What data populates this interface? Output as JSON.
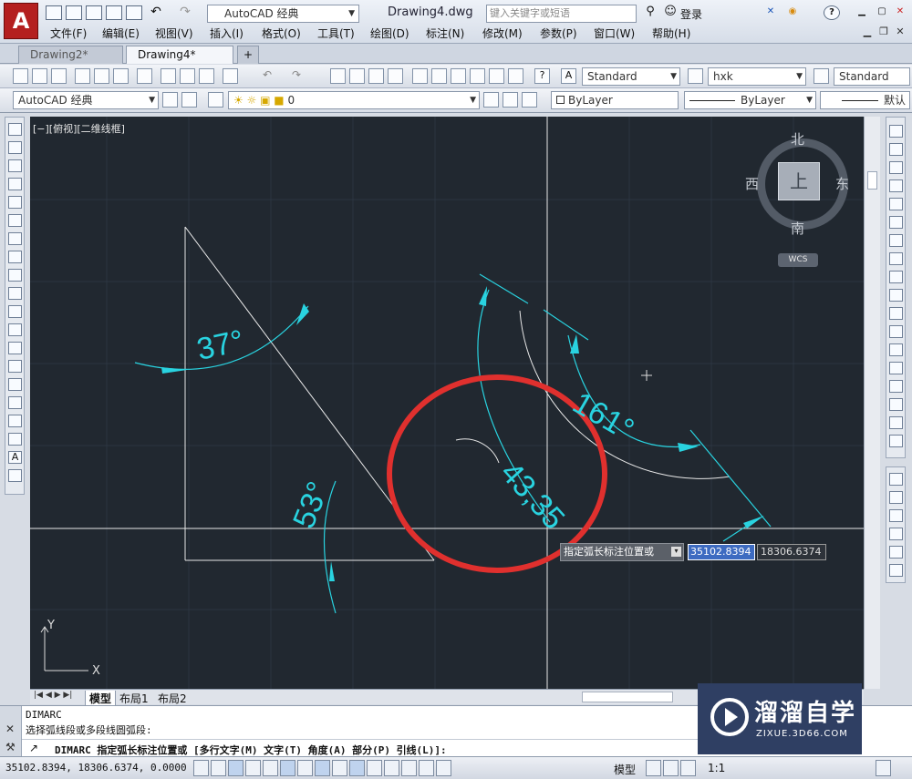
{
  "app": {
    "workspace": "AutoCAD 经典",
    "document_title": "Drawing4.dwg",
    "search_placeholder": "键入关键字或短语",
    "login": "登录"
  },
  "menu": [
    "文件(F)",
    "编辑(E)",
    "视图(V)",
    "插入(I)",
    "格式(O)",
    "工具(T)",
    "绘图(D)",
    "标注(N)",
    "修改(M)",
    "参数(P)",
    "窗口(W)",
    "帮助(H)"
  ],
  "doc_tabs": [
    "Drawing2*",
    "Drawing4*"
  ],
  "toolbar": {
    "text_style": "Standard",
    "dim_style": "hxk",
    "table_style": "Standard",
    "workspace2": "AutoCAD 经典",
    "layer": "0",
    "color": "ByLayer",
    "linetype": "ByLayer",
    "lineweight": "默认"
  },
  "viewport_label": "[−][俯视][二维线框]",
  "viewcube": {
    "north": "北",
    "south": "南",
    "east": "东",
    "west": "西",
    "face": "上",
    "wcs": "WCS"
  },
  "drawing": {
    "angle_a": "37°",
    "angle_b": "53°",
    "angle_c": "161°",
    "arc_length": "43,35"
  },
  "dynamic_input": {
    "prompt": "指定弧长标注位置或",
    "x": "35102.8394",
    "y": "18306.6374"
  },
  "layout_tabs": [
    "模型",
    "布局1",
    "布局2"
  ],
  "command": {
    "line1": "DIMARC",
    "line2": "选择弧线段或多段线圆弧段:",
    "input": "DIMARC 指定弧长标注位置或 [多行文字(M) 文字(T) 角度(A) 部分(P) 引线(L)]:"
  },
  "status": {
    "coords": "35102.8394, 18306.6374, 0.0000",
    "model": "模型",
    "scale": "1:1"
  },
  "watermark": {
    "title": "溜溜自学",
    "subtitle": "ZIXUE.3D66.COM"
  },
  "colors": {
    "canvas": "#212830",
    "dimension": "#29d3e0",
    "geometry": "#e8e8e8",
    "highlight": "#e0302e"
  }
}
